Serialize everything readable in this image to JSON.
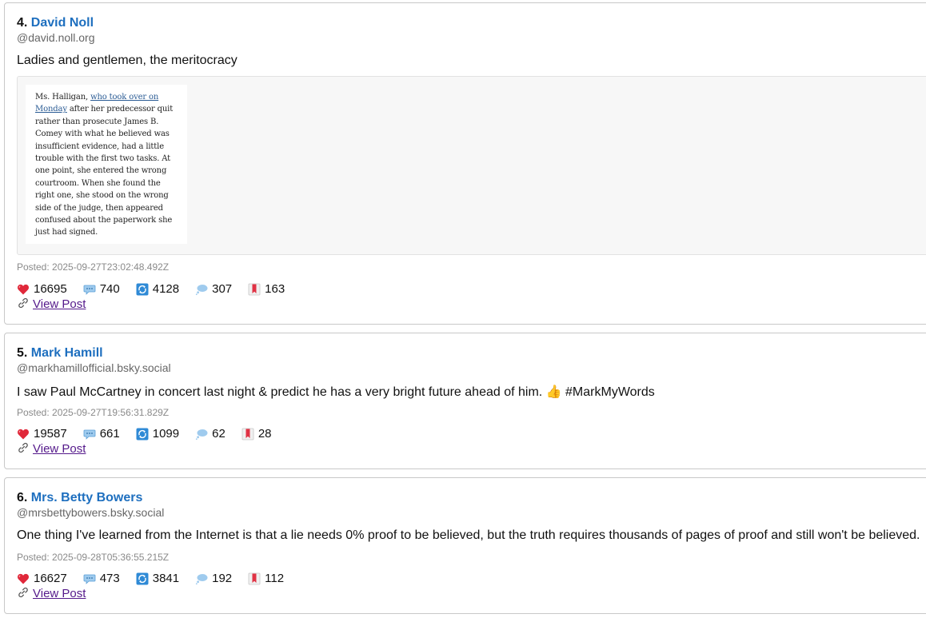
{
  "posts": [
    {
      "rank": "4",
      "author": "David Noll",
      "handle": "@david.noll.org",
      "text": "Ladies and gentlemen, the meritocracy",
      "embed_lines": [
        {
          "pre": "Ms. Halligan, ",
          "link": "who took over on",
          "post": ""
        },
        {
          "pre": "",
          "link": "Monday",
          "post": " after her predecessor quit"
        },
        {
          "pre": "rather than prosecute James B.",
          "link": "",
          "post": ""
        },
        {
          "pre": "Comey with what he believed was",
          "link": "",
          "post": ""
        },
        {
          "pre": "insufficient evidence, had a little",
          "link": "",
          "post": ""
        },
        {
          "pre": "trouble with the first two tasks. At",
          "link": "",
          "post": ""
        },
        {
          "pre": "one point, she entered the wrong",
          "link": "",
          "post": ""
        },
        {
          "pre": "courtroom. When she found the",
          "link": "",
          "post": ""
        },
        {
          "pre": "right one, she stood on the wrong",
          "link": "",
          "post": ""
        },
        {
          "pre": "side of the judge, then appeared",
          "link": "",
          "post": ""
        },
        {
          "pre": "confused about the paperwork she",
          "link": "",
          "post": ""
        },
        {
          "pre": "just had signed.",
          "link": "",
          "post": ""
        }
      ],
      "posted": "Posted: 2025-09-27T23:02:48.492Z",
      "likes": "16695",
      "replies": "740",
      "reposts": "4128",
      "quotes": "307",
      "bookmarks": "163",
      "view_label": "View Post"
    },
    {
      "rank": "5",
      "author": "Mark Hamill",
      "handle": "@markhamillofficial.bsky.social",
      "text": "I saw Paul McCartney in concert last night & predict he has a very bright future ahead of him. 👍 #MarkMyWords",
      "posted": "Posted: 2025-09-27T19:56:31.829Z",
      "likes": "19587",
      "replies": "661",
      "reposts": "1099",
      "quotes": "62",
      "bookmarks": "28",
      "view_label": "View Post"
    },
    {
      "rank": "6",
      "author": "Mrs. Betty Bowers",
      "handle": "@mrsbettybowers.bsky.social",
      "text": "One thing I've learned from the Internet is that a lie needs 0% proof to be believed, but the truth requires thousands of pages of proof and still won't be believed.",
      "posted": "Posted: 2025-09-28T05:36:55.215Z",
      "likes": "16627",
      "replies": "473",
      "reposts": "3841",
      "quotes": "192",
      "bookmarks": "112",
      "view_label": "View Post"
    }
  ],
  "icons": {
    "like": "heart-icon",
    "reply": "speech-bubble-icon",
    "repost": "repeat-icon",
    "quote": "thought-bubble-icon",
    "bookmark": "bookmark-icon",
    "link": "link-icon"
  },
  "colors": {
    "author_link": "#1e6fbf",
    "visited_link": "#551a8b",
    "heart": "#e0283a"
  }
}
